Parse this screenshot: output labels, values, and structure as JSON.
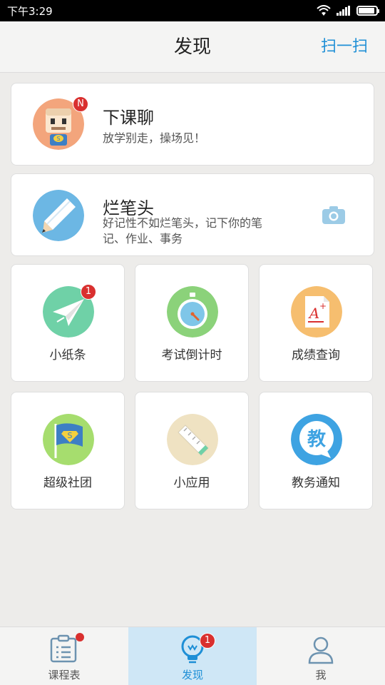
{
  "status_bar": {
    "time": "下午3:29",
    "battery_level": 0.9
  },
  "header": {
    "title": "发现",
    "scan_label": "扫一扫"
  },
  "features": {
    "chat": {
      "title": "下课聊",
      "subtitle": "放学别走，操场见！",
      "badge": "N"
    },
    "notes": {
      "title": "烂笔头",
      "subtitle_line1": "好记性不如烂笔头，记下你的笔",
      "subtitle_line2": "记、作业、事务"
    }
  },
  "grid": [
    {
      "label": "小纸条",
      "badge": "1",
      "icon": "paper-plane-icon"
    },
    {
      "label": "考试倒计时",
      "icon": "stopwatch-icon"
    },
    {
      "label": "成绩查询",
      "icon": "grade-paper-icon"
    },
    {
      "label": "超级社团",
      "icon": "club-flag-icon"
    },
    {
      "label": "小应用",
      "icon": "ruler-icon"
    },
    {
      "label": "教务通知",
      "icon": "notice-bubble-icon",
      "glyph": "教"
    }
  ],
  "tabs": [
    {
      "label": "课程表",
      "icon": "schedule-clipboard-icon"
    },
    {
      "label": "发现",
      "badge": "1",
      "icon": "lightbulb-icon",
      "active": true
    },
    {
      "label": "我",
      "icon": "person-icon"
    }
  ],
  "colors": {
    "accent": "#1e8fd6",
    "badge": "#d9302f",
    "active_tab_bg": "#cfe7f6"
  }
}
